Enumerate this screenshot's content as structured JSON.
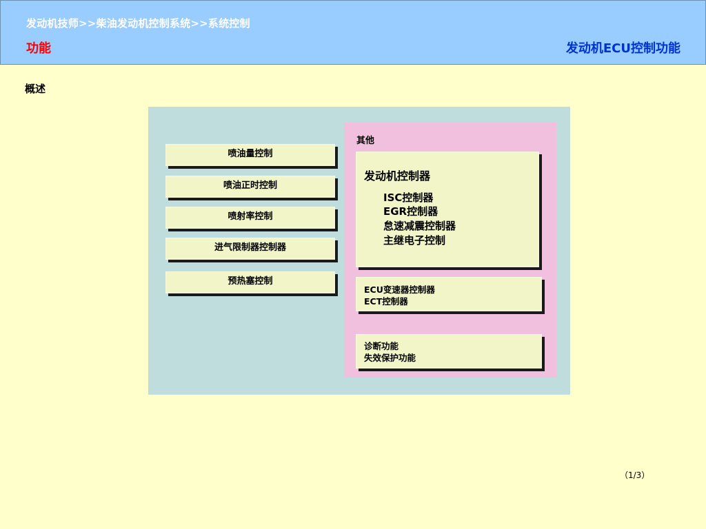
{
  "header": {
    "breadcrumb": "发动机技师>>柴油发动机控制系统>>系统控制",
    "section_title": "功能",
    "right_title": "发动机ECU控制功能"
  },
  "main": {
    "overview_label": "概述",
    "left_items": [
      "喷油量控制",
      "喷油正时控制",
      "喷射率控制",
      "进气限制器控制器",
      "预热塞控制"
    ],
    "other": {
      "title": "其他",
      "engine_box": {
        "title": "发动机控制器",
        "items": [
          "ISC控制器",
          "EGR控制器",
          "怠速减震控制器",
          "主继电子控制"
        ]
      },
      "ecu_box": [
        "ECU变速器控制器",
        "ECT控制器"
      ],
      "diag_box": [
        "诊断功能",
        "失效保护功能"
      ]
    }
  },
  "footer": {
    "page_indicator": "（1/3）"
  },
  "colors": {
    "background": "#FFFFCC",
    "header": "#99CCFF",
    "section_title": "#FF0000",
    "right_title": "#0033CC",
    "diagram_bg": "#BFDDDD",
    "other_panel": "#F0C0DE",
    "box_fill": "#F2F5C8"
  }
}
